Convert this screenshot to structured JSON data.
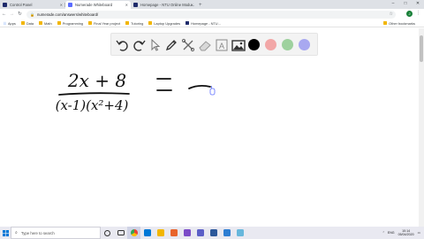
{
  "browser": {
    "tabs": [
      {
        "title": "Control Panel",
        "favicon_color": "#1f2b6b"
      },
      {
        "title": "Numerade Whiteboard",
        "favicon_color": "#5b6cff"
      },
      {
        "title": "Homepage - NTU Online Modu...",
        "favicon_color": "#1f2b6b"
      }
    ],
    "new_tab": "+",
    "window_controls": {
      "minimize": "–",
      "maximize": "□",
      "close": "✕"
    },
    "url": "numerade.com/answers/whiteboard/",
    "profile_initial": "J",
    "bookmarks": [
      {
        "label": "Apps",
        "icon": "apps-icon"
      },
      {
        "label": "Data",
        "icon": "folder-icon"
      },
      {
        "label": "Math",
        "icon": "folder-icon"
      },
      {
        "label": "Programming",
        "icon": "folder-icon"
      },
      {
        "label": "Final Year project",
        "icon": "folder-icon"
      },
      {
        "label": "Tutoring",
        "icon": "folder-icon"
      },
      {
        "label": "Laptop Upgrades",
        "icon": "folder-icon"
      },
      {
        "label": "Homepage - NTU...",
        "icon": "ntu-icon"
      }
    ],
    "other_bookmarks": "Other bookmarks"
  },
  "whiteboard": {
    "tools": [
      "undo-icon",
      "redo-icon",
      "select-icon",
      "pen-icon",
      "tools-icon",
      "eraser-icon",
      "text-icon",
      "image-icon"
    ],
    "colors": [
      "#000000",
      "#f2a7a7",
      "#9ed19e",
      "#a8a8f0"
    ],
    "expression": {
      "numerator": "2x + 8",
      "denominator": "(x-1)(x²+4)"
    }
  },
  "taskbar": {
    "search_placeholder": "Type here to search",
    "language": "ENG",
    "time": "10:14",
    "date": "05/04/2020"
  }
}
